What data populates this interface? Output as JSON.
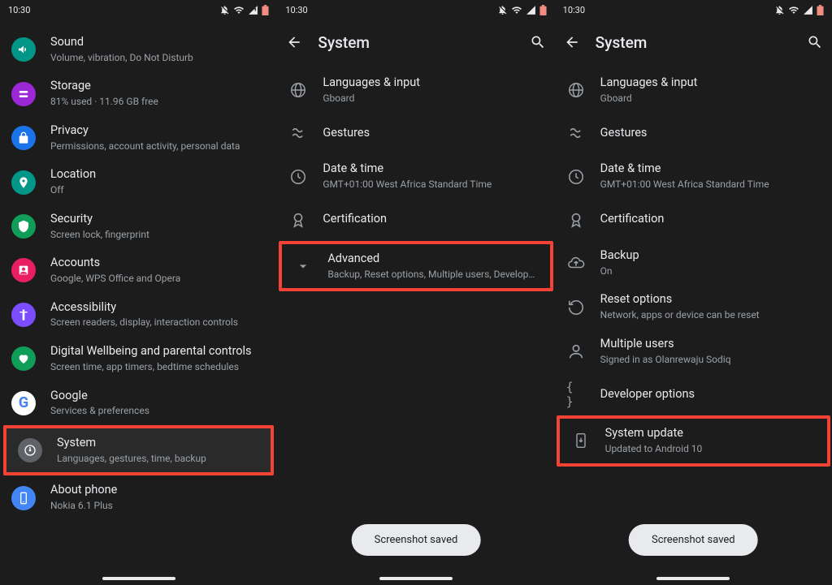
{
  "status": {
    "time": "10:30"
  },
  "panel1": {
    "items": [
      {
        "title": "Sound",
        "subtitle": "Volume, vibration, Do Not Disturb"
      },
      {
        "title": "Storage",
        "subtitle": "81% used · 11.96 GB free"
      },
      {
        "title": "Privacy",
        "subtitle": "Permissions, account activity, personal data"
      },
      {
        "title": "Location",
        "subtitle": "Off"
      },
      {
        "title": "Security",
        "subtitle": "Screen lock, fingerprint"
      },
      {
        "title": "Accounts",
        "subtitle": "Google, WPS Office and Opera"
      },
      {
        "title": "Accessibility",
        "subtitle": "Screen readers, display, interaction controls"
      },
      {
        "title": "Digital Wellbeing and parental controls",
        "subtitle": "Screen time, app timers, bedtime schedules"
      },
      {
        "title": "Google",
        "subtitle": "Services & preferences"
      },
      {
        "title": "System",
        "subtitle": "Languages, gestures, time, backup"
      },
      {
        "title": "About phone",
        "subtitle": "Nokia 6.1 Plus"
      }
    ]
  },
  "panel2": {
    "header": "System",
    "items": [
      {
        "title": "Languages & input",
        "subtitle": "Gboard"
      },
      {
        "title": "Gestures",
        "subtitle": ""
      },
      {
        "title": "Date & time",
        "subtitle": "GMT+01:00 West Africa Standard Time"
      },
      {
        "title": "Certification",
        "subtitle": ""
      },
      {
        "title": "Advanced",
        "subtitle": "Backup, Reset options, Multiple users, Developer o.."
      }
    ],
    "snackbar": "Screenshot saved"
  },
  "panel3": {
    "header": "System",
    "items": [
      {
        "title": "Languages & input",
        "subtitle": "Gboard"
      },
      {
        "title": "Gestures",
        "subtitle": ""
      },
      {
        "title": "Date & time",
        "subtitle": "GMT+01:00 West Africa Standard Time"
      },
      {
        "title": "Certification",
        "subtitle": ""
      },
      {
        "title": "Backup",
        "subtitle": "On"
      },
      {
        "title": "Reset options",
        "subtitle": "Network, apps or device can be reset"
      },
      {
        "title": "Multiple users",
        "subtitle": "Signed in as Olanrewaju Sodiq"
      },
      {
        "title": "Developer options",
        "subtitle": ""
      },
      {
        "title": "System update",
        "subtitle": "Updated to Android 10"
      }
    ],
    "snackbar": "Screenshot saved"
  }
}
